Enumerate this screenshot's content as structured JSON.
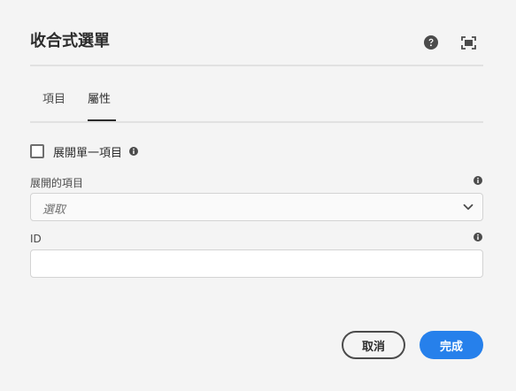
{
  "dialog": {
    "title": "收合式選單"
  },
  "header": {
    "help_icon": "help-icon",
    "fullscreen_icon": "fullscreen-icon"
  },
  "tabs": [
    {
      "label": "項目",
      "selected": false
    },
    {
      "label": "屬性",
      "selected": true
    }
  ],
  "form": {
    "single_expansion": {
      "label": "展開單一項目",
      "checked": false
    },
    "expanded_items": {
      "label": "展開的項目",
      "placeholder": "選取"
    },
    "id": {
      "label": "ID",
      "value": ""
    }
  },
  "footer": {
    "cancel_label": "取消",
    "done_label": "完成"
  },
  "colors": {
    "background": "#f4f4f4",
    "primary": "#2680eb",
    "text": "#2c2c2c",
    "border": "#d3d3d3"
  }
}
